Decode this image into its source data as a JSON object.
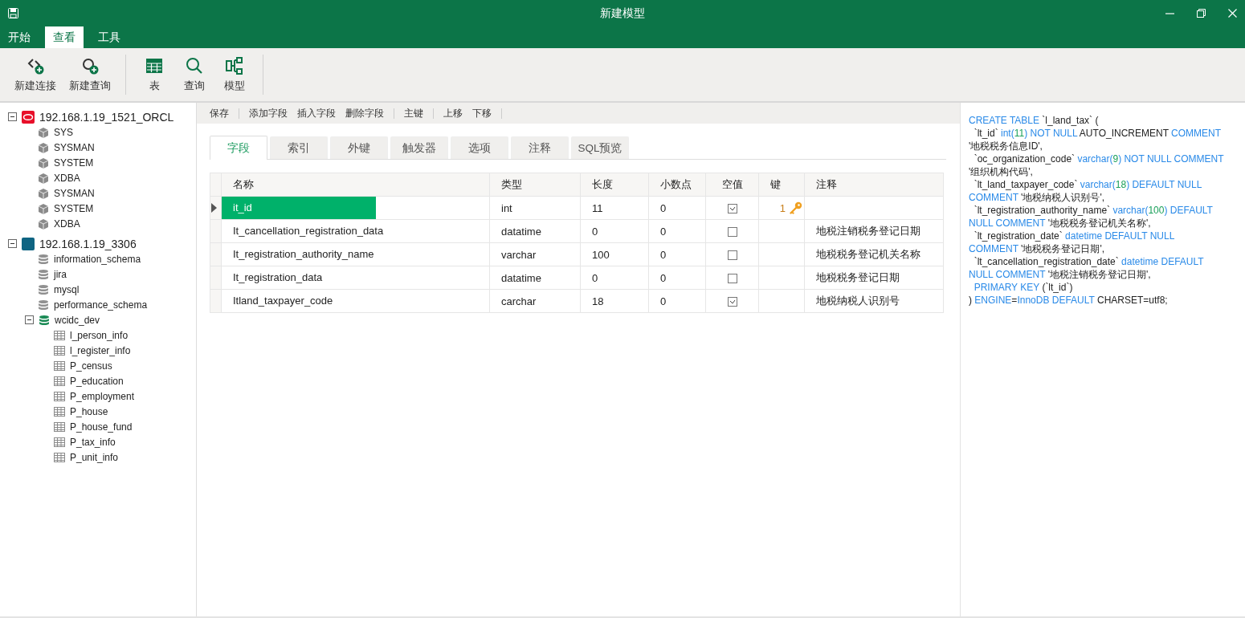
{
  "window": {
    "title": "新建模型"
  },
  "menu_tabs": [
    {
      "label": "开始",
      "selected": false
    },
    {
      "label": "查看",
      "selected": true
    },
    {
      "label": "工具",
      "selected": false
    }
  ],
  "toolbar": [
    {
      "kind": "new-connection",
      "label": "新建连接"
    },
    {
      "kind": "new-query",
      "label": "新建查询"
    },
    {
      "kind": "separator"
    },
    {
      "kind": "table",
      "label": "表"
    },
    {
      "kind": "query",
      "label": "查询"
    },
    {
      "kind": "model",
      "label": "模型"
    }
  ],
  "tree": [
    {
      "kind": "oracle",
      "label": "192.168.1.19_1521_ORCL",
      "expanded": true,
      "children": [
        {
          "kind": "schema",
          "label": "SYS"
        },
        {
          "kind": "schema",
          "label": "SYSMAN"
        },
        {
          "kind": "schema",
          "label": "SYSTEM"
        },
        {
          "kind": "schema",
          "label": "XDBA"
        },
        {
          "kind": "schema",
          "label": "SYSMAN"
        },
        {
          "kind": "schema",
          "label": "SYSTEM"
        },
        {
          "kind": "schema",
          "label": "XDBA"
        }
      ]
    },
    {
      "kind": "mysql",
      "label": "192.168.1.19_3306",
      "expanded": true,
      "children": [
        {
          "kind": "database",
          "label": "information_schema"
        },
        {
          "kind": "database",
          "label": "jira"
        },
        {
          "kind": "database",
          "label": "mysql"
        },
        {
          "kind": "database",
          "label": "performance_schema"
        },
        {
          "kind": "database-open",
          "label": "wcidc_dev",
          "expanded": true,
          "children": [
            {
              "kind": "table",
              "label": "l_person_info"
            },
            {
              "kind": "table",
              "label": "l_register_info"
            },
            {
              "kind": "table",
              "label": "P_census"
            },
            {
              "kind": "table",
              "label": "P_education"
            },
            {
              "kind": "table",
              "label": "P_employment"
            },
            {
              "kind": "table",
              "label": "P_house"
            },
            {
              "kind": "table",
              "label": "P_house_fund"
            },
            {
              "kind": "table",
              "label": "P_tax_info"
            },
            {
              "kind": "table",
              "label": "P_unit_info"
            }
          ]
        }
      ]
    }
  ],
  "actions": [
    {
      "kind": "button",
      "label": "保存"
    },
    {
      "kind": "separator"
    },
    {
      "kind": "button",
      "label": "添加字段"
    },
    {
      "kind": "button",
      "label": "插入字段"
    },
    {
      "kind": "button",
      "label": "删除字段"
    },
    {
      "kind": "separator"
    },
    {
      "kind": "button",
      "label": "主键"
    },
    {
      "kind": "separator"
    },
    {
      "kind": "button",
      "label": "上移"
    },
    {
      "kind": "button",
      "label": "下移"
    },
    {
      "kind": "separator"
    }
  ],
  "editor_tabs": [
    {
      "label": "字段",
      "selected": true
    },
    {
      "label": "索引",
      "selected": false
    },
    {
      "label": "外键",
      "selected": false
    },
    {
      "label": "触发器",
      "selected": false
    },
    {
      "label": "选项",
      "selected": false
    },
    {
      "label": "注释",
      "selected": false
    },
    {
      "label": "SQL预览",
      "selected": false
    }
  ],
  "fields": {
    "columns": [
      "名称",
      "类型",
      "长度",
      "小数点",
      "空值",
      "键",
      "注释"
    ],
    "rows": [
      {
        "name": "it_id",
        "type": "int",
        "length": "11",
        "decimals": "0",
        "nullable": true,
        "key": "1",
        "comment": "",
        "selected": true
      },
      {
        "name": "It_cancellation_registration_data",
        "type": "datatime",
        "length": "0",
        "decimals": "0",
        "nullable": false,
        "comment": "地税注销税务登记日期",
        "selected": false
      },
      {
        "name": "It_registration_authority_name",
        "type": "varchar",
        "length": "100",
        "decimals": "0",
        "nullable": false,
        "comment": "地税税务登记机关名称",
        "selected": false
      },
      {
        "name": "It_registration_data",
        "type": "datatime",
        "length": "0",
        "decimals": "0",
        "nullable": false,
        "comment": "地税税务登记日期",
        "selected": false
      },
      {
        "name": "Itland_taxpayer_code",
        "type": "carchar",
        "length": "18",
        "decimals": "0",
        "nullable": true,
        "comment": "地税纳税人识别号",
        "selected": false
      }
    ]
  },
  "sql_preview": [
    [
      {
        "kind": "keyword",
        "text": "CREATE TABLE"
      },
      {
        "kind": "plain",
        "text": " `l_land_tax` ("
      }
    ],
    [
      {
        "kind": "plain",
        "text": "  `lt_id` "
      },
      {
        "kind": "keyword",
        "text": "int("
      },
      {
        "kind": "number",
        "text": "11"
      },
      {
        "kind": "keyword",
        "text": ") NOT NULL"
      },
      {
        "kind": "plain",
        "text": " AUTO_INCREMENT "
      },
      {
        "kind": "keyword",
        "text": "COMMENT"
      }
    ],
    [
      {
        "kind": "plain",
        "text": "'地税税务信息ID',"
      }
    ],
    [
      {
        "kind": "plain",
        "text": "  `oc_organization_code` "
      },
      {
        "kind": "keyword",
        "text": "varchar("
      },
      {
        "kind": "number",
        "text": "9"
      },
      {
        "kind": "keyword",
        "text": ") NOT NULL COMMENT"
      }
    ],
    [
      {
        "kind": "plain",
        "text": "'组织机构代码',"
      }
    ],
    [
      {
        "kind": "plain",
        "text": "  `lt_land_taxpayer_code` "
      },
      {
        "kind": "keyword",
        "text": "varchar("
      },
      {
        "kind": "number",
        "text": "18"
      },
      {
        "kind": "keyword",
        "text": ") DEFAULT NULL"
      }
    ],
    [
      {
        "kind": "keyword",
        "text": "COMMENT"
      },
      {
        "kind": "plain",
        "text": " '地税纳税人识别号',"
      }
    ],
    [
      {
        "kind": "plain",
        "text": "  `lt_registration_authority_name` "
      },
      {
        "kind": "keyword",
        "text": "varchar("
      },
      {
        "kind": "number",
        "text": "100"
      },
      {
        "kind": "keyword",
        "text": ") DEFAULT"
      }
    ],
    [
      {
        "kind": "keyword",
        "text": "NULL COMMENT"
      },
      {
        "kind": "plain",
        "text": " '地税税务登记机关名称',"
      }
    ],
    [
      {
        "kind": "plain",
        "text": "  `lt_registration_date` "
      },
      {
        "kind": "keyword",
        "text": "datetime DEFAULT NULL"
      }
    ],
    [
      {
        "kind": "keyword",
        "text": "COMMENT"
      },
      {
        "kind": "plain",
        "text": " '地税税务登记日期',"
      }
    ],
    [
      {
        "kind": "plain",
        "text": "  `lt_cancellation_registration_date` "
      },
      {
        "kind": "keyword",
        "text": "datetime DEFAULT"
      }
    ],
    [
      {
        "kind": "keyword",
        "text": "NULL COMMENT"
      },
      {
        "kind": "plain",
        "text": " '地税注销税务登记日期',"
      }
    ],
    [
      {
        "kind": "keyword",
        "text": "  PRIMARY KEY"
      },
      {
        "kind": "plain",
        "text": " (`lt_id`)"
      }
    ],
    [
      {
        "kind": "plain",
        "text": ") "
      },
      {
        "kind": "keyword",
        "text": "ENGINE"
      },
      {
        "kind": "plain",
        "text": "="
      },
      {
        "kind": "keyword",
        "text": "InnoDB DEFAULT"
      },
      {
        "kind": "plain",
        "text": " CHARSET=utf8;"
      }
    ]
  ]
}
